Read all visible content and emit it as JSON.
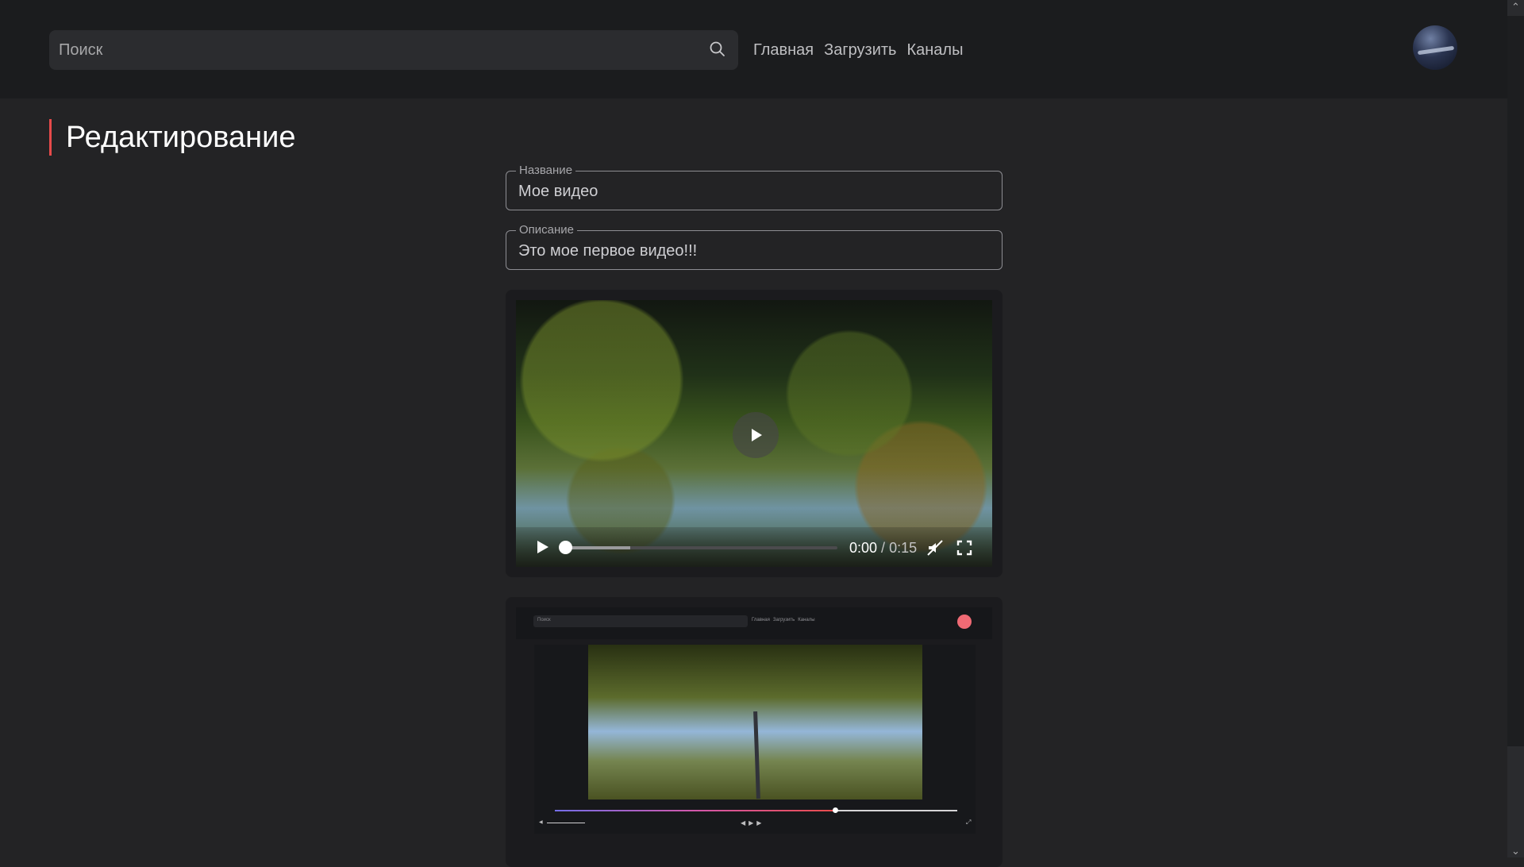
{
  "header": {
    "search_placeholder": "Поиск",
    "nav": [
      "Главная",
      "Загрузить",
      "Каналы"
    ]
  },
  "page": {
    "title": "Редактирование"
  },
  "form": {
    "title_label": "Название",
    "title_value": "Мое видео",
    "description_label": "Описание",
    "description_value": "Это мое первое видео!!!"
  },
  "player": {
    "current_time": "0:00",
    "separator": " / ",
    "duration": "0:15",
    "progress_fraction": 0,
    "buffered_fraction": 0.24
  },
  "thumbnail_preview": {
    "search_placeholder": "Поиск",
    "nav": [
      "Главная",
      "Загрузить",
      "Каналы"
    ],
    "progress_fraction": 0.7
  },
  "icons": {
    "search": "search-icon",
    "play": "play-icon",
    "mute": "mute-icon",
    "fullscreen": "fullscreen-icon"
  },
  "colors": {
    "accent": "#e64a4a",
    "background": "#232325",
    "header": "#1b1c1e"
  }
}
